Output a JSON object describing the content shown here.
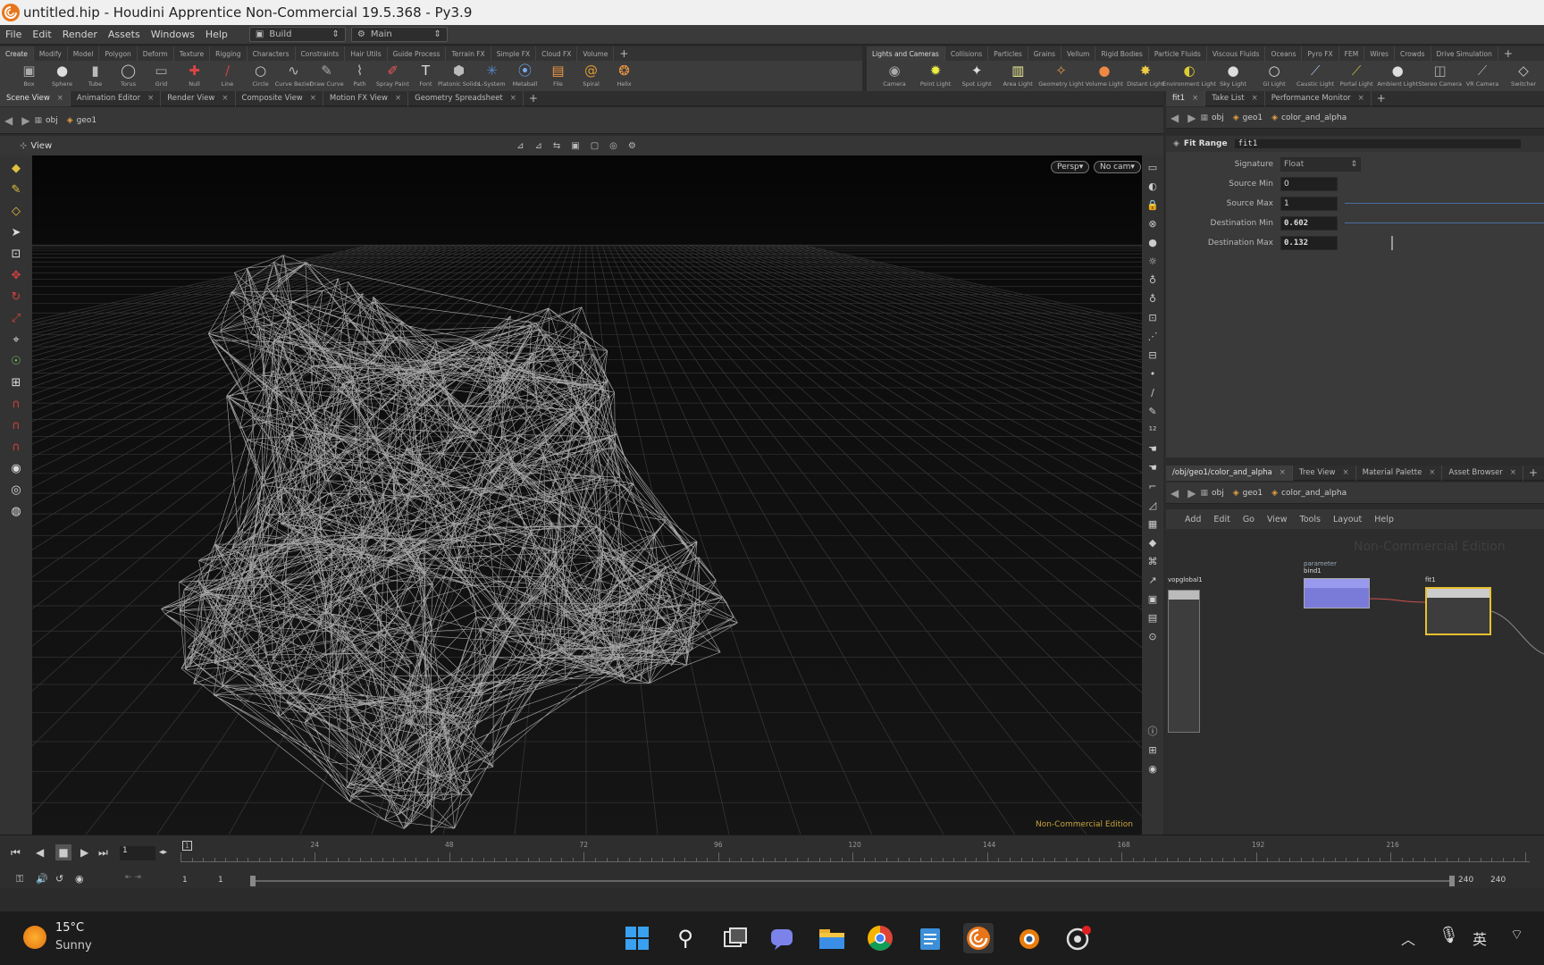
{
  "window": {
    "title": "untitled.hip - Houdini Apprentice Non-Commercial 19.5.368 - Py3.9"
  },
  "menubar": {
    "items": [
      "File",
      "Edit",
      "Render",
      "Assets",
      "Windows",
      "Help"
    ],
    "desktop": "Build",
    "context": "Main"
  },
  "shelf_tabs_left": [
    "Create",
    "Modify",
    "Model",
    "Polygon",
    "Deform",
    "Texture",
    "Rigging",
    "Characters",
    "Constraints",
    "Hair Utils",
    "Guide Process",
    "Terrain FX",
    "Simple FX",
    "Cloud FX",
    "Volume"
  ],
  "shelf_tabs_right": [
    "Lights and Cameras",
    "Collisions",
    "Particles",
    "Grains",
    "Vellum",
    "Rigid Bodies",
    "Particle Fluids",
    "Viscous Fluids",
    "Oceans",
    "Pyro FX",
    "FEM",
    "Wires",
    "Crowds",
    "Drive Simulation"
  ],
  "shelf_tools_left": [
    "Box",
    "Sphere",
    "Tube",
    "Torus",
    "Grid",
    "Null",
    "Line",
    "Circle",
    "Curve Bezier",
    "Draw Curve",
    "Path",
    "Spray Paint",
    "Font",
    "Platonic Solids",
    "L-System",
    "Metaball",
    "File",
    "Spiral",
    "Helix"
  ],
  "shelf_tools_right": [
    "Camera",
    "Point Light",
    "Spot Light",
    "Area Light",
    "Geometry Light",
    "Volume Light",
    "Distant Light",
    "Environment Light",
    "Sky Light",
    "GI Light",
    "Caustic Light",
    "Portal Light",
    "Ambient Light",
    "Stereo Camera",
    "VR Camera",
    "Switcher"
  ],
  "left_tabs": [
    "Scene View",
    "Animation Editor",
    "Render View",
    "Composite View",
    "Motion FX View",
    "Geometry Spreadsheet"
  ],
  "path": {
    "obj": "obj",
    "geo": "geo1",
    "node": "color_and_alpha"
  },
  "viewport": {
    "label": "View",
    "persp": "Persp",
    "cam": "No cam",
    "watermark": "Non-Commercial Edition"
  },
  "param_tabs": [
    "fit1",
    "Take List",
    "Performance Monitor"
  ],
  "params": {
    "node_type": "Fit Range",
    "node_name": "fit1",
    "rows": [
      {
        "label": "Signature",
        "value": "Float"
      },
      {
        "label": "Source Min",
        "value": "0"
      },
      {
        "label": "Source Max",
        "value": "1"
      },
      {
        "label": "Destination Min",
        "value": "0.602"
      },
      {
        "label": "Destination Max",
        "value": "0.132"
      }
    ]
  },
  "net_tabs": [
    "/obj/geo1/color_and_alpha",
    "Tree View",
    "Material Palette",
    "Asset Browser"
  ],
  "net_menu": [
    "Add",
    "Edit",
    "Go",
    "View",
    "Tools",
    "Layout",
    "Help"
  ],
  "net_watermark": "Non-Commercial Edition",
  "nodes": {
    "global": "vopglobal1",
    "bind_type": "parameter",
    "bind": "bind1",
    "fit": "fit1"
  },
  "timeline": {
    "frame": "1",
    "ticks": [
      "1",
      "24",
      "48",
      "72",
      "96",
      "120",
      "144",
      "168",
      "192",
      "216"
    ],
    "start": "1",
    "start2": "1",
    "end": "240",
    "end2": "240"
  },
  "taskbar": {
    "temp": "15°C",
    "weather": "Sunny",
    "ime": "英"
  }
}
